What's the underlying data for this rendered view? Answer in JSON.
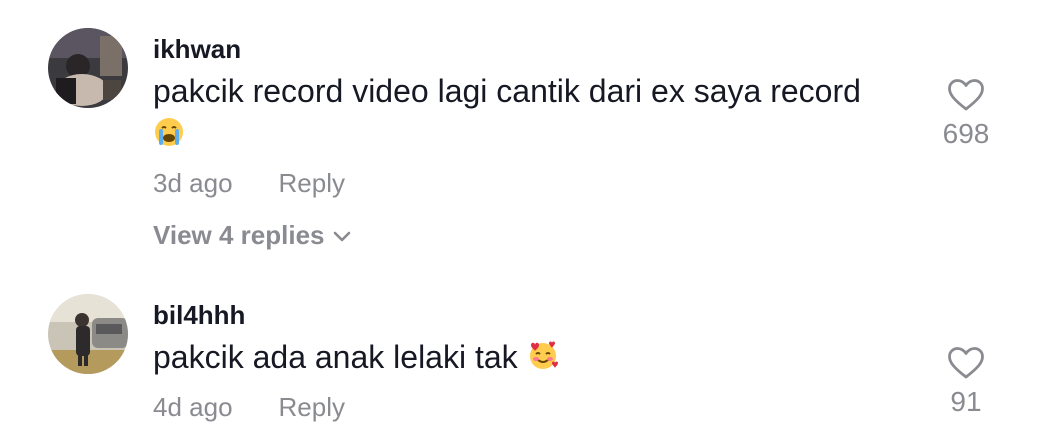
{
  "comments": [
    {
      "username": "ikhwan",
      "text": "pakcik record video lagi cantik dari ex saya record",
      "emoji": "loudly-crying-face",
      "time": "3d ago",
      "reply_label": "Reply",
      "likes": "698",
      "view_replies": "View 4 replies"
    },
    {
      "username": "bil4hhh",
      "text": "pakcik ada anak lelaki tak",
      "emoji": "smiling-face-with-hearts",
      "time": "4d ago",
      "reply_label": "Reply",
      "likes": "91"
    }
  ],
  "colors": {
    "primary_text": "#161823",
    "secondary_text": "#8a8b91",
    "icon": "#8a8b91"
  }
}
